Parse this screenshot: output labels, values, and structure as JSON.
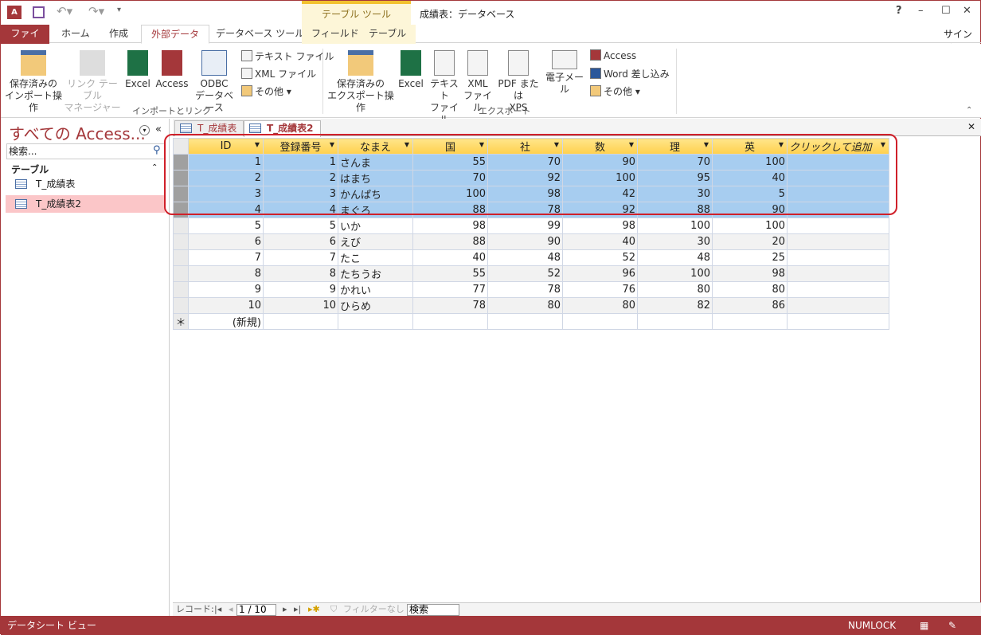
{
  "app": {
    "title": "成績表：データベース",
    "tool_context": "テーブル ツール",
    "help": "?",
    "signin": "サインイン"
  },
  "tabs": [
    "ファイル",
    "ホーム",
    "作成",
    "外部データ",
    "データベース ツール",
    "フィールド",
    "テーブル"
  ],
  "active_tab": "外部データ",
  "ribbon": {
    "import": {
      "group": "インポートとリンク",
      "saved": [
        "保存済みの",
        "インポート操作"
      ],
      "linkmgr": [
        "リンク テーブル",
        "マネージャー"
      ],
      "excel": "Excel",
      "access": "Access",
      "odbc": [
        "ODBC",
        "データベース"
      ],
      "text": "テキスト ファイル",
      "xml": "XML ファイル",
      "more": "その他"
    },
    "export": {
      "group": "エクスポート",
      "saved": [
        "保存済みの",
        "エクスポート操作"
      ],
      "excel": "Excel",
      "text": [
        "テキスト",
        "ファイル"
      ],
      "xml": [
        "XML",
        "ファイル"
      ],
      "pdf": [
        "PDF または",
        "XPS"
      ],
      "email": "電子メール",
      "access": "Access",
      "word": "Word 差し込み",
      "more": "その他"
    }
  },
  "nav": {
    "title": "すべての Access...",
    "search_placeholder": "検索...",
    "category": "テーブル",
    "items": [
      "T_成績表",
      "T_成績表2"
    ],
    "selected": "T_成績表2"
  },
  "doc_tabs": [
    "T_成績表",
    "T_成績表2"
  ],
  "datasheet": {
    "columns": [
      "ID",
      "登録番号",
      "なまえ",
      "国",
      "社",
      "数",
      "理",
      "英",
      "クリックして追加"
    ],
    "rows": [
      [
        1,
        1,
        "さんま",
        55,
        70,
        90,
        70,
        100
      ],
      [
        2,
        2,
        "はまち",
        70,
        92,
        100,
        95,
        40
      ],
      [
        3,
        3,
        "かんぱち",
        100,
        98,
        42,
        30,
        5
      ],
      [
        4,
        4,
        "まぐろ",
        88,
        78,
        92,
        88,
        90
      ],
      [
        5,
        5,
        "いか",
        98,
        99,
        98,
        100,
        100
      ],
      [
        6,
        6,
        "えび",
        88,
        90,
        40,
        30,
        20
      ],
      [
        7,
        7,
        "たこ",
        40,
        48,
        52,
        48,
        25
      ],
      [
        8,
        8,
        "たちうお",
        55,
        52,
        96,
        100,
        98
      ],
      [
        9,
        9,
        "かれい",
        77,
        78,
        76,
        80,
        80
      ],
      [
        10,
        10,
        "ひらめ",
        78,
        80,
        80,
        82,
        86
      ]
    ],
    "selected_rows": [
      1,
      2,
      3,
      4
    ],
    "new_row_marker": "＊",
    "new_row_label": "(新規)"
  },
  "record_nav": {
    "label": "レコード:",
    "current": "1 / 10",
    "filter": "フィルターなし",
    "search": "検索"
  },
  "status": {
    "view": "データシート ビュー",
    "numlock": "NUMLOCK"
  },
  "colors": {
    "accent": "#a4373a",
    "header": "#ffd04d",
    "selection": "#a7cdf0",
    "highlight": "#d0202a"
  }
}
